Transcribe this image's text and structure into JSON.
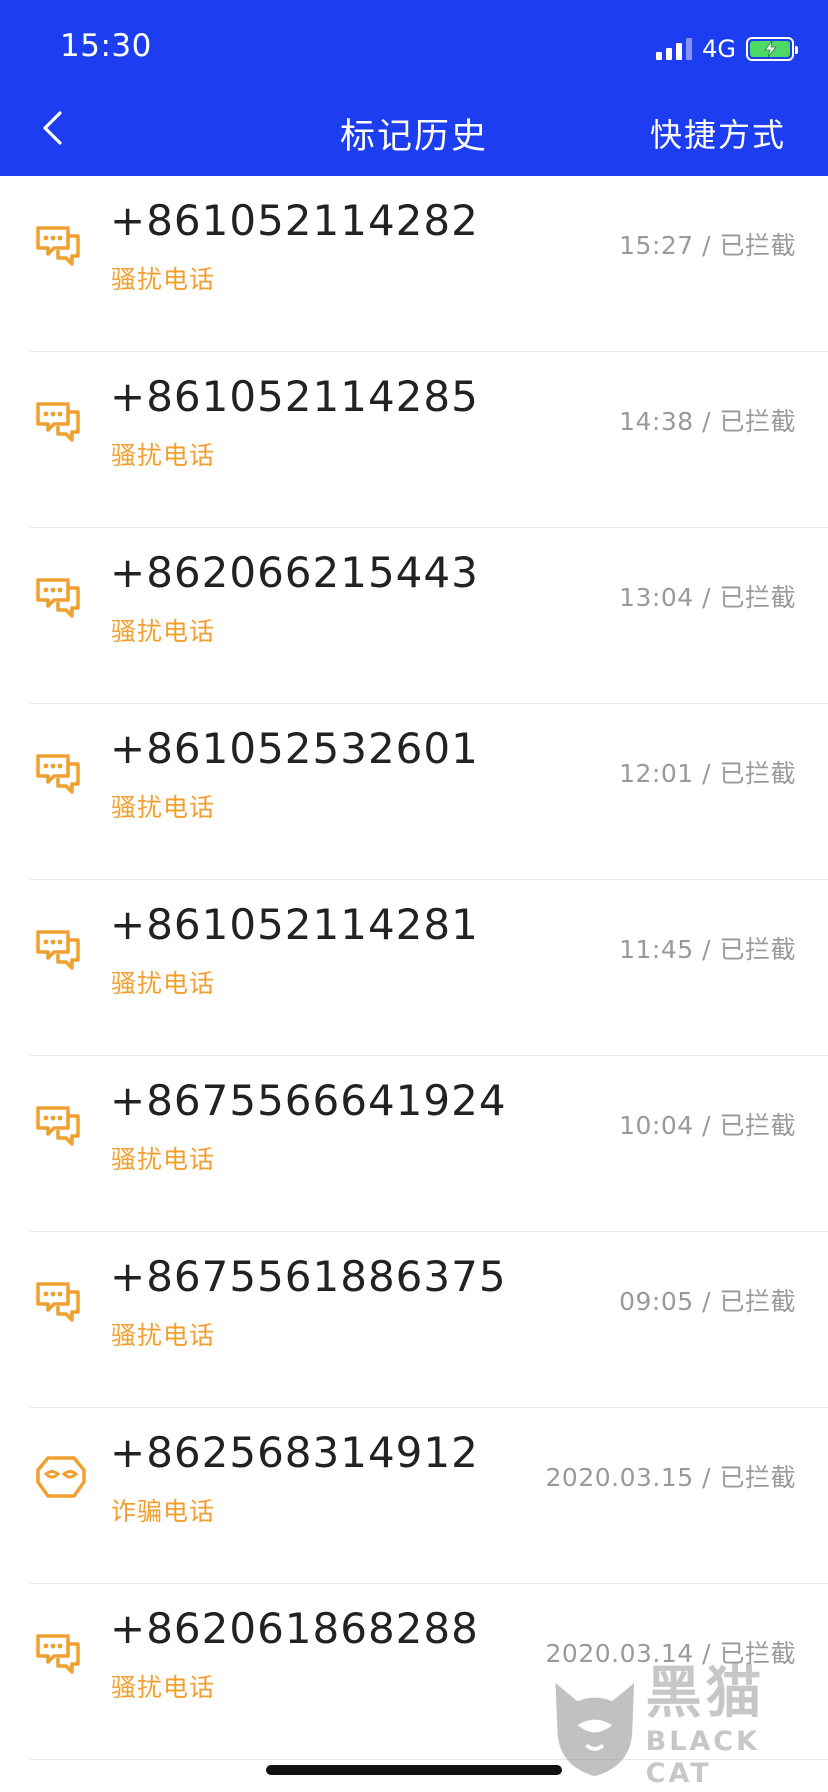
{
  "status_bar": {
    "time": "15:30",
    "network": "4G",
    "battery_charging": true
  },
  "nav": {
    "title": "标记历史",
    "right_action": "快捷方式",
    "back_icon": "chevron-left-icon"
  },
  "colors": {
    "header_bg": "#1d3ef0",
    "tag_orange": "#f0a030",
    "meta_gray": "#9a9a9e",
    "battery_green": "#4cd964"
  },
  "records": [
    {
      "number": "+861052114282",
      "tag": "骚扰电话",
      "meta": "15:27 / 已拦截",
      "icon": "harassment-icon"
    },
    {
      "number": "+861052114285",
      "tag": "骚扰电话",
      "meta": "14:38 / 已拦截",
      "icon": "harassment-icon"
    },
    {
      "number": "+862066215443",
      "tag": "骚扰电话",
      "meta": "13:04 / 已拦截",
      "icon": "harassment-icon"
    },
    {
      "number": "+861052532601",
      "tag": "骚扰电话",
      "meta": "12:01 / 已拦截",
      "icon": "harassment-icon"
    },
    {
      "number": "+861052114281",
      "tag": "骚扰电话",
      "meta": "11:45 / 已拦截",
      "icon": "harassment-icon"
    },
    {
      "number": "+8675566641924",
      "tag": "骚扰电话",
      "meta": "10:04 / 已拦截",
      "icon": "harassment-icon"
    },
    {
      "number": "+8675561886375",
      "tag": "骚扰电话",
      "meta": "09:05 / 已拦截",
      "icon": "harassment-icon"
    },
    {
      "number": "+862568314912",
      "tag": "诈骗电话",
      "meta": "2020.03.15 / 已拦截",
      "icon": "fraud-mask-icon"
    },
    {
      "number": "+862061868288",
      "tag": "骚扰电话",
      "meta": "2020.03.14 / 已拦截",
      "icon": "harassment-icon"
    }
  ],
  "watermark": {
    "cn": "黑猫",
    "en": "BLACK CAT"
  }
}
